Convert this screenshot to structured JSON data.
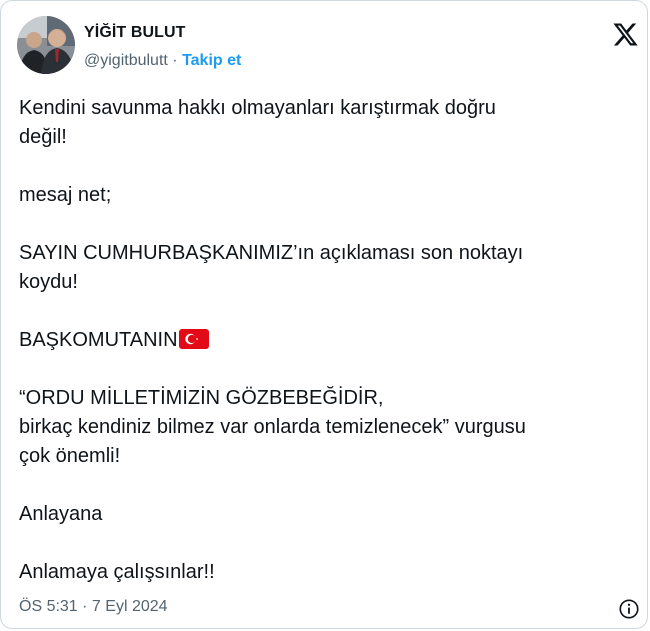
{
  "author": {
    "name": "YİĞİT BULUT",
    "handle": "@yigitbulutt",
    "separator": " · ",
    "follow_label": "Takip et"
  },
  "logo_icon": "x-logo-icon",
  "tweet": {
    "line1": "Kendini savunma hakkı olmayanları karıştırmak doğru",
    "line2": "değil!",
    "line3": "mesaj net;",
    "line4": "SAYIN CUMHURBAŞKANIMIZ’ın açıklaması son noktayı",
    "line5": "koydu!",
    "line6": "BAŞKOMUTANIN",
    "line6_emoji": "turkey-flag-icon",
    "line7": "“ORDU MİLLETİMİZİN GÖZBEBEĞİDİR,",
    "line8": "birkaç kendiniz bilmez var onlarda temizlenecek” vurgusu",
    "line9": "çok önemli!",
    "line10": "Anlayana",
    "line11": "Anlamaya çalışsınlar!!"
  },
  "timestamp": "ÖS 5:31 · 7 Eyl 2024",
  "info_icon": "info-icon",
  "colors": {
    "text": "#0f1419",
    "secondary": "#536471",
    "link": "#1d9bf0",
    "border": "#cfd9de",
    "flag_red": "#e30a17"
  }
}
